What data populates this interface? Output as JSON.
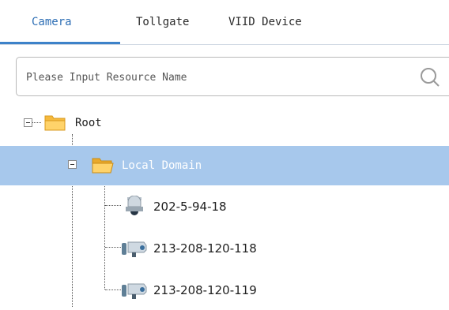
{
  "tabs": [
    {
      "label": "Camera",
      "active": true
    },
    {
      "label": "Tollgate",
      "active": false
    },
    {
      "label": "VIID Device",
      "active": false
    }
  ],
  "search": {
    "placeholder": "Please Input Resource Name",
    "value": ""
  },
  "tree": {
    "root": {
      "label": "Root",
      "icon": "folder-icon",
      "expanded": true
    },
    "local_domain": {
      "label": "Local Domain",
      "icon": "folder-open-icon",
      "expanded": true,
      "selected": true
    },
    "devices": [
      {
        "label": "202-5-94-18",
        "icon": "dome-camera-icon"
      },
      {
        "label": "213-208-120-118",
        "icon": "bullet-camera-icon"
      },
      {
        "label": "213-208-120-119",
        "icon": "bullet-camera-icon"
      }
    ]
  },
  "colors": {
    "accent": "#3d82c9",
    "active_tab_text": "#2e6fb5",
    "selected_row": "#a7c8ec",
    "folder": "#f5b93d"
  }
}
